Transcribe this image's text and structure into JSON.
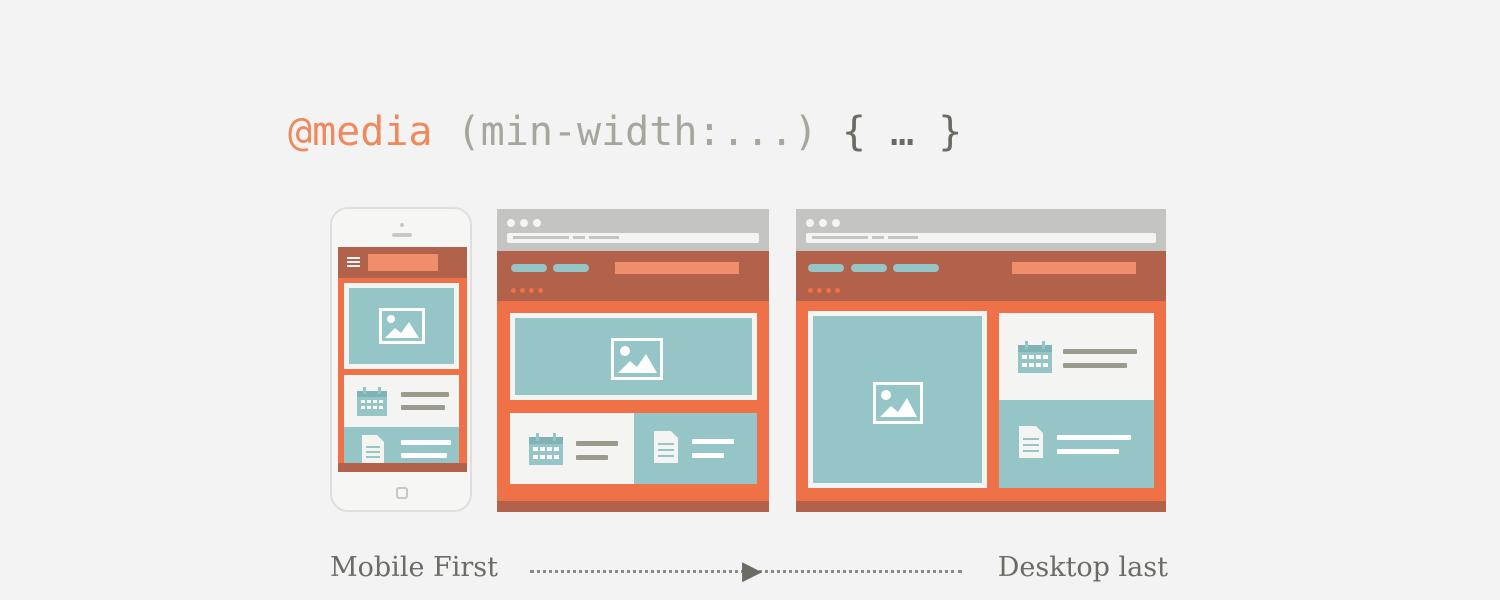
{
  "code": {
    "at_rule": "@media",
    "condition": "(min-width:...)",
    "block": "{ … }"
  },
  "caption": {
    "left": "Mobile First",
    "right": "Desktop last"
  },
  "icons": {
    "image": "image-placeholder-icon",
    "calendar": "calendar-icon",
    "document": "document-icon",
    "menu": "hamburger-menu-icon",
    "arrow": "arrow-right-icon"
  },
  "colors": {
    "orange": "#ef7148",
    "brown": "#b2614a",
    "teal": "#95c5c6",
    "code_at": "#ee8a5e",
    "code_text": "#a6a69c"
  }
}
